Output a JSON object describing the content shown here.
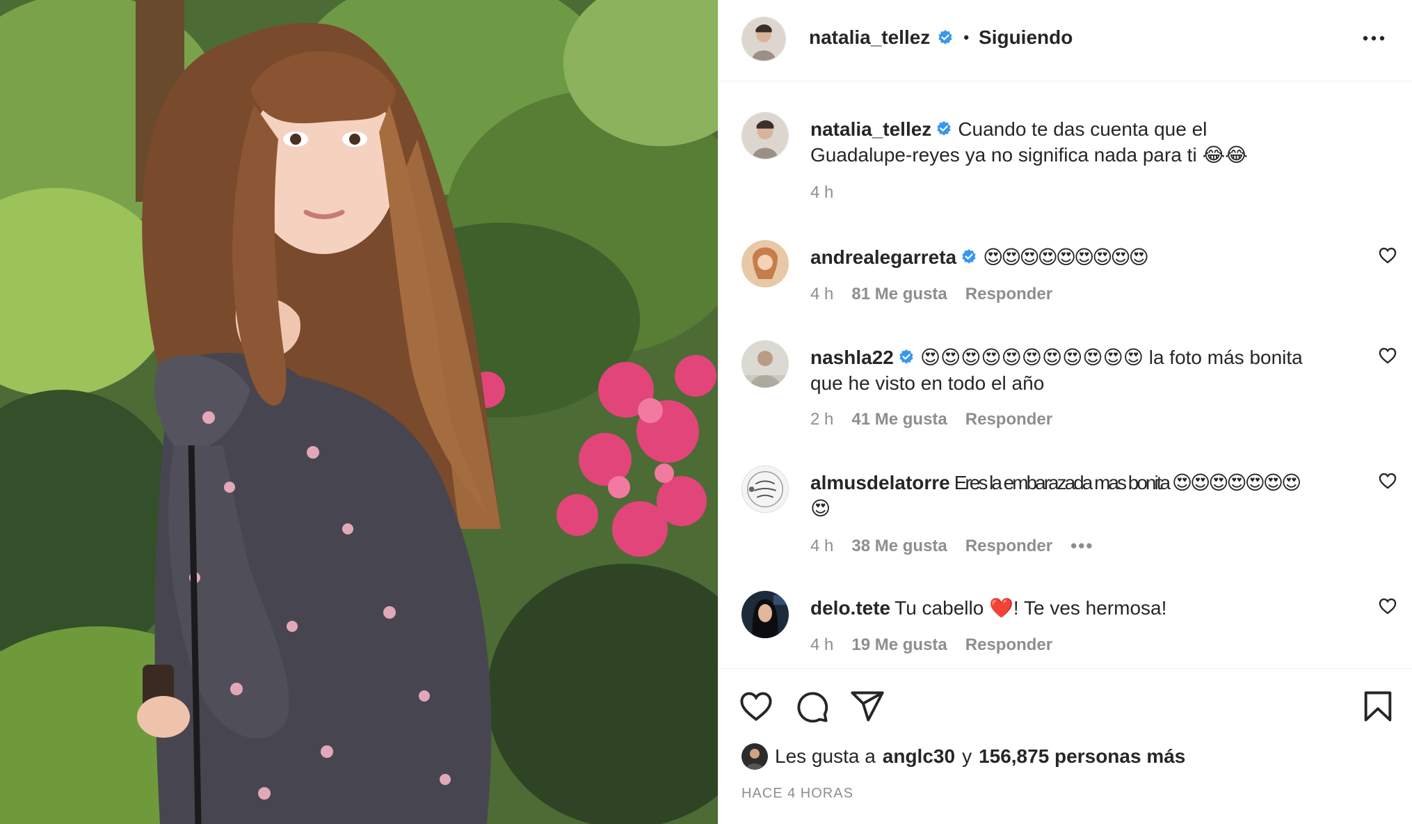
{
  "post": {
    "author": "natalia_tellez",
    "follow_state": "Siguiendo",
    "separator": "•",
    "caption": "Cuando te das cuenta que el Guadalupe-reyes ya no significa nada para ti 😂😂",
    "caption_time": "4 h"
  },
  "comments": [
    {
      "user": "andrealegarreta",
      "verified": true,
      "text": "😍😍😍😍😍😍😍😍😍",
      "time": "4 h",
      "likes": "81 Me gusta",
      "reply": "Responder"
    },
    {
      "user": "nashla22",
      "verified": true,
      "text": "😍😍😍😍😍😍😍😍😍😍😍 la foto más bonita que he visto en todo el año",
      "time": "2 h",
      "likes": "41 Me gusta",
      "reply": "Responder"
    },
    {
      "user": "almusdelatorre",
      "verified": false,
      "text": "Eres la embarazada mas bonita 😍😍😍😍😍😍😍😍",
      "time": "4 h",
      "likes": "38 Me gusta",
      "reply": "Responder",
      "more": "•••"
    },
    {
      "user": "delo.tete",
      "verified": false,
      "text": "Tu cabello ❤️! Te ves hermosa!",
      "time": "4 h",
      "likes": "19 Me gusta",
      "reply": "Responder"
    }
  ],
  "likes_line": {
    "prefix": "Les gusta a",
    "user": "anglc30",
    "connector": "y",
    "count": "156,875 personas más"
  },
  "timestamp": "HACE 4 HORAS",
  "icons": [
    "verified-badge-icon",
    "more-options-icon",
    "heart-icon",
    "comment-icon",
    "share-icon",
    "bookmark-icon"
  ],
  "colors": {
    "verified": "#3897f0",
    "text": "#262626",
    "muted": "#8e8e8e",
    "border": "#efefef"
  }
}
